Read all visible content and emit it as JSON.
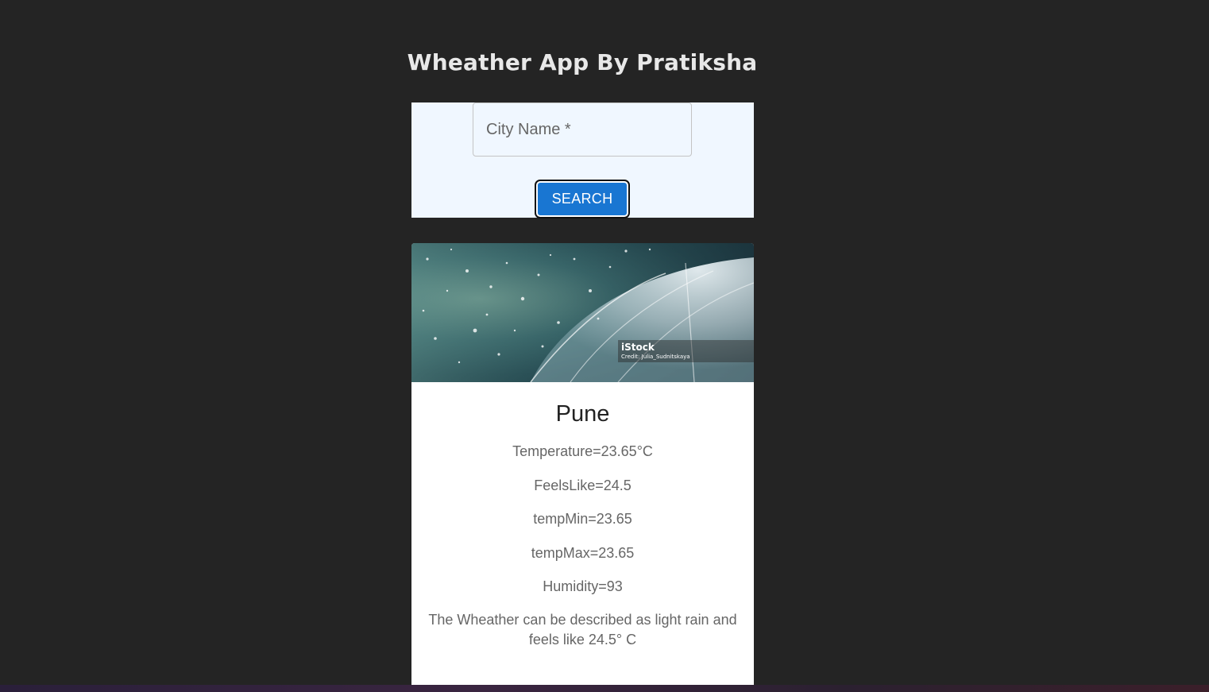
{
  "app": {
    "title": "Wheather App By Pratiksha"
  },
  "search": {
    "placeholder": "City Name *",
    "value": "",
    "button_label": "Search"
  },
  "card": {
    "image_watermark": {
      "brand": "iStock",
      "credit": "Credit: Julia_Sudnitskaya"
    },
    "city": "Pune",
    "temperature": "Temperature=23.65°C",
    "feels_like": "FeelsLike=24.5",
    "temp_min": "tempMin=23.65",
    "temp_max": "tempMax=23.65",
    "humidity": "Humidity=93",
    "description": "The Wheather can be described as light rain and feels like 24.5° C"
  },
  "colors": {
    "page_background": "#242424",
    "search_panel_background": "#f0f7ff",
    "button_primary": "#1976d2",
    "card_background": "#ffffff"
  }
}
